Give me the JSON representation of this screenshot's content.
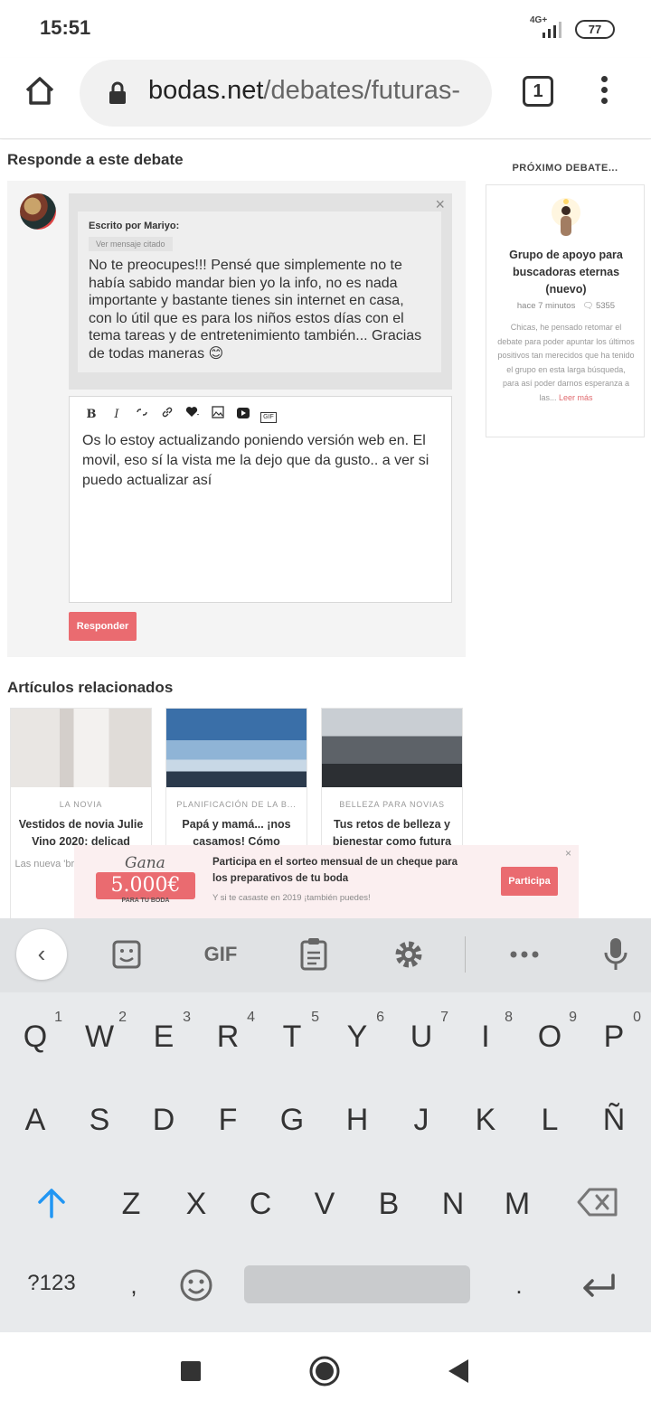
{
  "status_bar": {
    "time": "15:51",
    "network": "4G+",
    "battery": "77"
  },
  "browser": {
    "url_domain": "bodas.net",
    "url_path": "/debates/futuras-",
    "tab_count": "1"
  },
  "reply": {
    "heading": "Responde a este debate",
    "quote_close": "×",
    "quote_author": "Escrito por Mariyo:",
    "quote_cited_label": "Ver mensaje citado",
    "quote_text": "No te preocupes!!! Pensé que simplemente no te había sabido mandar bien yo la info, no es nada importante y bastante tienes sin internet en casa, con lo útil que es para los niños estos días con el tema tareas y de entretenimiento también... Gracias de todas maneras 😊",
    "editor_text": "Os lo estoy actualizando poniendo versión web en. El movil, eso sí la vista me la dejo que da gusto.. a ver si puedo actualizar así",
    "toolbar": {
      "bold": "B",
      "italic": "I",
      "gif": "GIF"
    },
    "respond_label": "Responder"
  },
  "next_debate": {
    "heading": "PRÓXIMO DEBATE...",
    "title": "Grupo de apoyo para buscadoras eternas (nuevo)",
    "time": "hace 7 minutos",
    "comments": "5355",
    "excerpt": "Chicas, he pensado retomar el debate para poder apuntar los últimos positivos tan merecidos que ha tenido el grupo en esta larga búsqueda, para así poder darnos esperanza a las...",
    "read_more": "Leer más"
  },
  "related": {
    "heading": "Artículos relacionados",
    "articles": [
      {
        "category": "LA NOVIA",
        "title": "Vestidos de novia Julie Vino 2020: delicad",
        "excerpt": "Las nueva 'bridal' de permitirá"
      },
      {
        "category": "PLANIFICACIÓN DE LA B...",
        "title": "Papá y mamá... ¡nos casamos! Cómo",
        "excerpt": ""
      },
      {
        "category": "BELLEZA PARA NOVIAS",
        "title": "Tus retos de belleza y bienestar como futura",
        "excerpt": ""
      }
    ]
  },
  "promo": {
    "gana": "Gana",
    "amount": "5.000€",
    "amount_sub": "PARA TU BODA",
    "text": "Participa en el sorteo mensual de un cheque para los preparativos de tu boda",
    "small": "Y si te casaste en 2019 ¡también puedes!",
    "button": "Participa",
    "close": "×"
  },
  "keyboard": {
    "toolbar_gif": "GIF",
    "row1": [
      {
        "k": "Q",
        "n": "1"
      },
      {
        "k": "W",
        "n": "2"
      },
      {
        "k": "E",
        "n": "3"
      },
      {
        "k": "R",
        "n": "4"
      },
      {
        "k": "T",
        "n": "5"
      },
      {
        "k": "Y",
        "n": "6"
      },
      {
        "k": "U",
        "n": "7"
      },
      {
        "k": "I",
        "n": "8"
      },
      {
        "k": "O",
        "n": "9"
      },
      {
        "k": "P",
        "n": "0"
      }
    ],
    "row2": [
      "A",
      "S",
      "D",
      "F",
      "G",
      "H",
      "J",
      "K",
      "L",
      "Ñ"
    ],
    "row3": [
      "Z",
      "X",
      "C",
      "V",
      "B",
      "N",
      "M"
    ],
    "symbols": "?123",
    "comma": ",",
    "period": "."
  },
  "colors": {
    "accent": "#ea6b70",
    "keyboard_bg": "#e8eaec",
    "shift_blue": "#2196f3"
  }
}
